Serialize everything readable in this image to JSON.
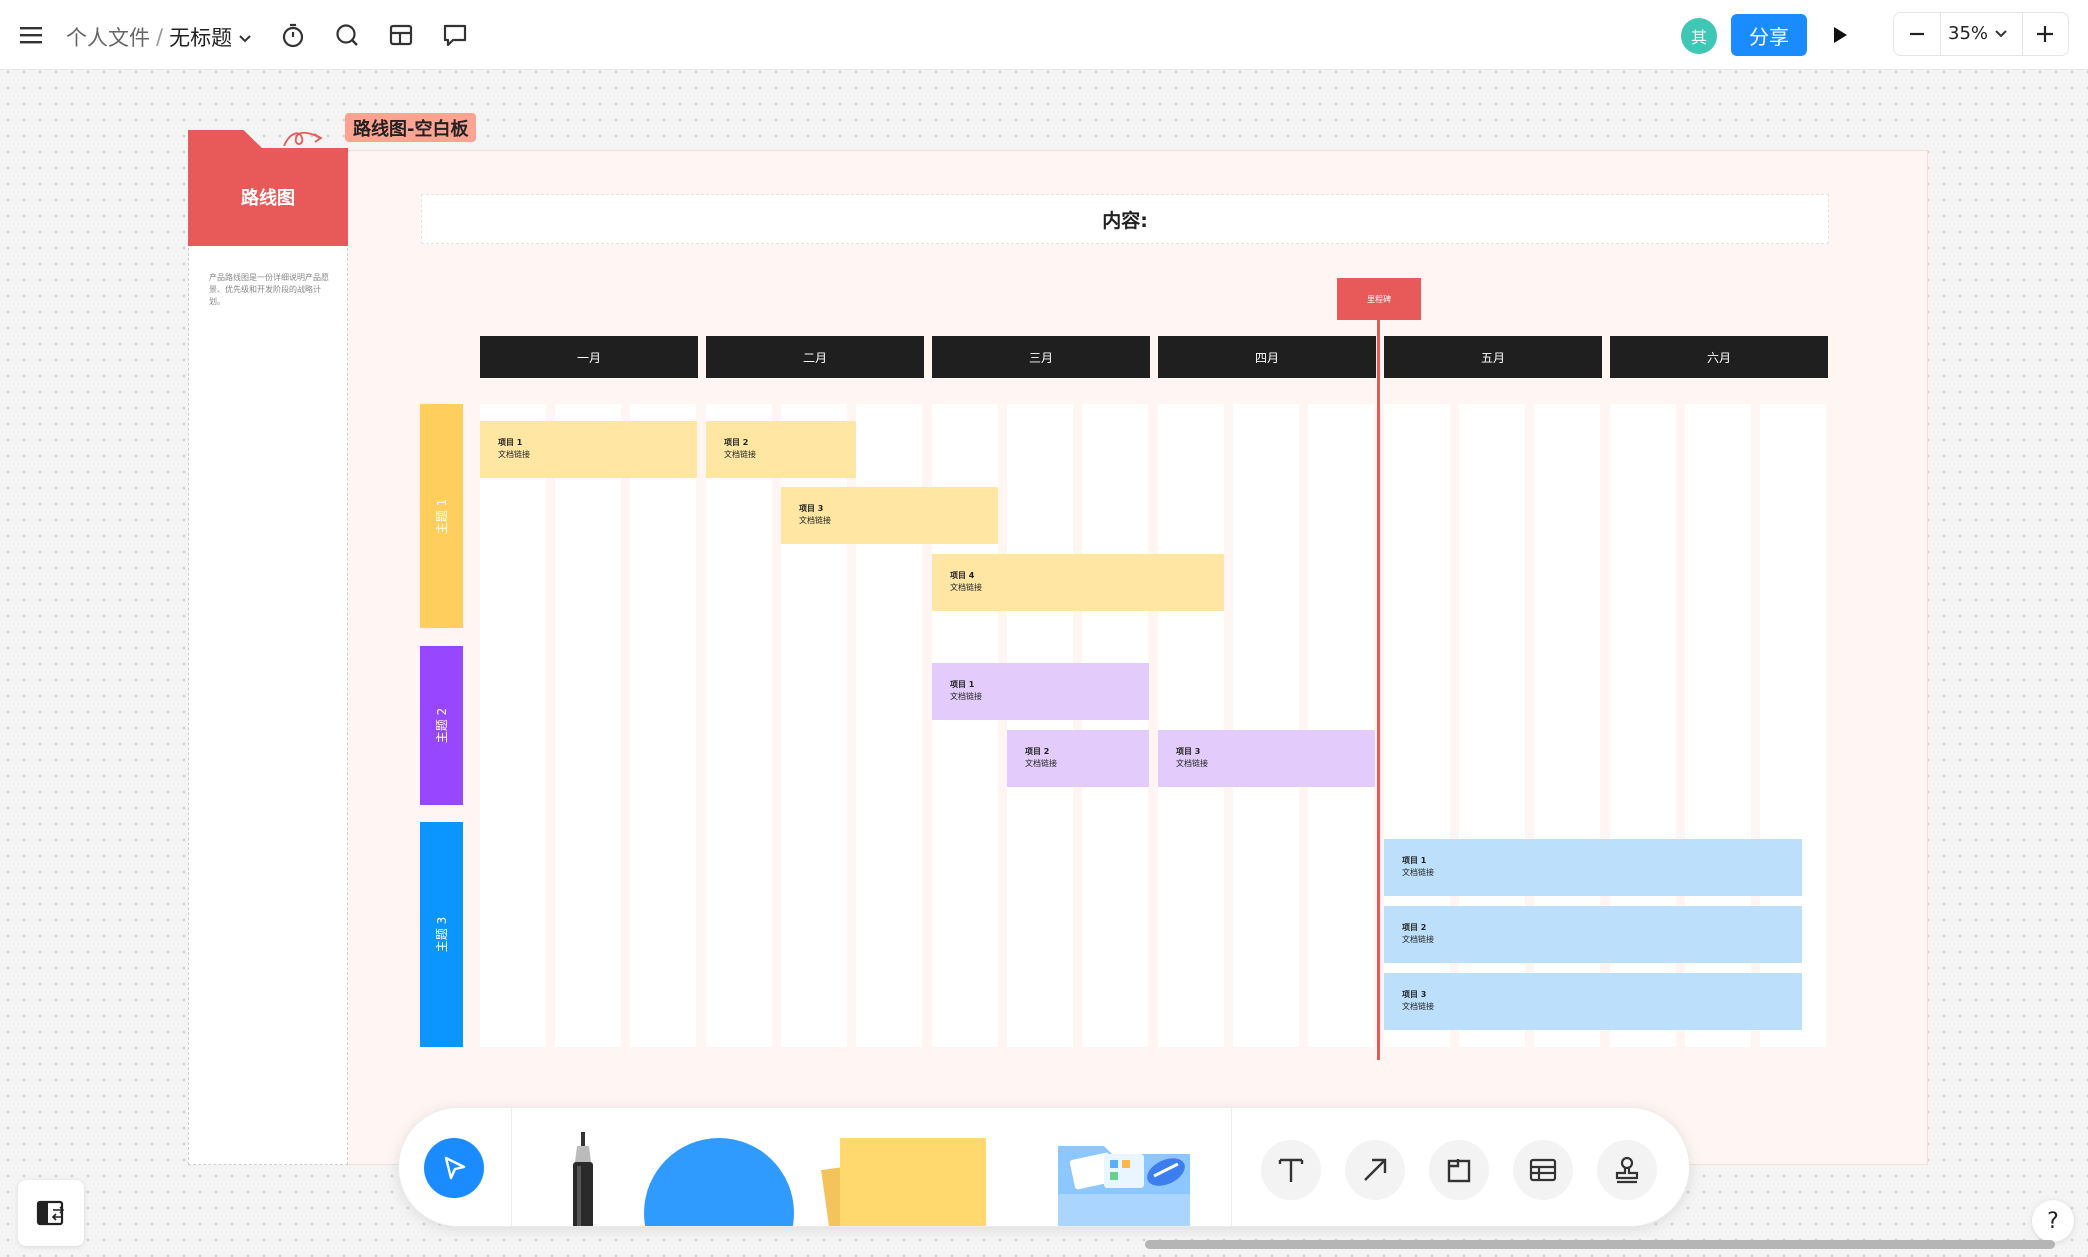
{
  "topbar": {
    "breadcrumb_folder": "个人文件",
    "breadcrumb_separator": "/",
    "document_title": "无标题",
    "avatar_initial": "其",
    "share_label": "分享",
    "zoom_level": "35%"
  },
  "frame": {
    "title_tag": "路线图-空白板",
    "panel_title": "路线图",
    "panel_description": "产品路线图是一份详细说明产品愿景、优先级和开发阶段的战略计划。",
    "content_label": "内容:",
    "milestone_label": "里程碑"
  },
  "months": [
    "一月",
    "二月",
    "三月",
    "四月",
    "五月",
    "六月"
  ],
  "themes": [
    {
      "label": "主题 1",
      "color": "#ffce5c"
    },
    {
      "label": "主题 2",
      "color": "#9747ff"
    },
    {
      "label": "主题 3",
      "color": "#0b96ff"
    }
  ],
  "cards": [
    {
      "title": "项目 1",
      "subtitle": "文档链接",
      "theme": 1
    },
    {
      "title": "项目 2",
      "subtitle": "文档链接",
      "theme": 1
    },
    {
      "title": "项目 3",
      "subtitle": "文档链接",
      "theme": 1
    },
    {
      "title": "项目 4",
      "subtitle": "文档链接",
      "theme": 1
    },
    {
      "title": "项目 1",
      "subtitle": "文档链接",
      "theme": 2
    },
    {
      "title": "项目 2",
      "subtitle": "文档链接",
      "theme": 2
    },
    {
      "title": "项目 3",
      "subtitle": "文档链接",
      "theme": 2
    },
    {
      "title": "项目 1",
      "subtitle": "文档链接",
      "theme": 3
    },
    {
      "title": "项目 2",
      "subtitle": "文档链接",
      "theme": 3
    },
    {
      "title": "项目 3",
      "subtitle": "文档链接",
      "theme": 3
    }
  ],
  "colors": {
    "accent": "#1a8cff",
    "frame_red": "#e85a5a",
    "card_yellow": "#ffe6a3",
    "card_purple": "#e3ccfc",
    "card_blue": "#bce0fc"
  },
  "icons": {
    "topbar": [
      "menu-icon",
      "timer-icon",
      "search-icon",
      "template-icon",
      "comment-icon",
      "play-icon",
      "zoom-out-icon",
      "chevron-down-icon",
      "zoom-in-icon"
    ],
    "dock": [
      "select-tool-icon",
      "pen-tool",
      "shape-tool",
      "sticky-note-tool",
      "folder-tool",
      "text-icon",
      "arrow-icon",
      "frame-icon",
      "table-icon",
      "stamp-icon"
    ],
    "other": [
      "sidebar-toggle-icon",
      "help-icon"
    ]
  },
  "help_label": "?"
}
